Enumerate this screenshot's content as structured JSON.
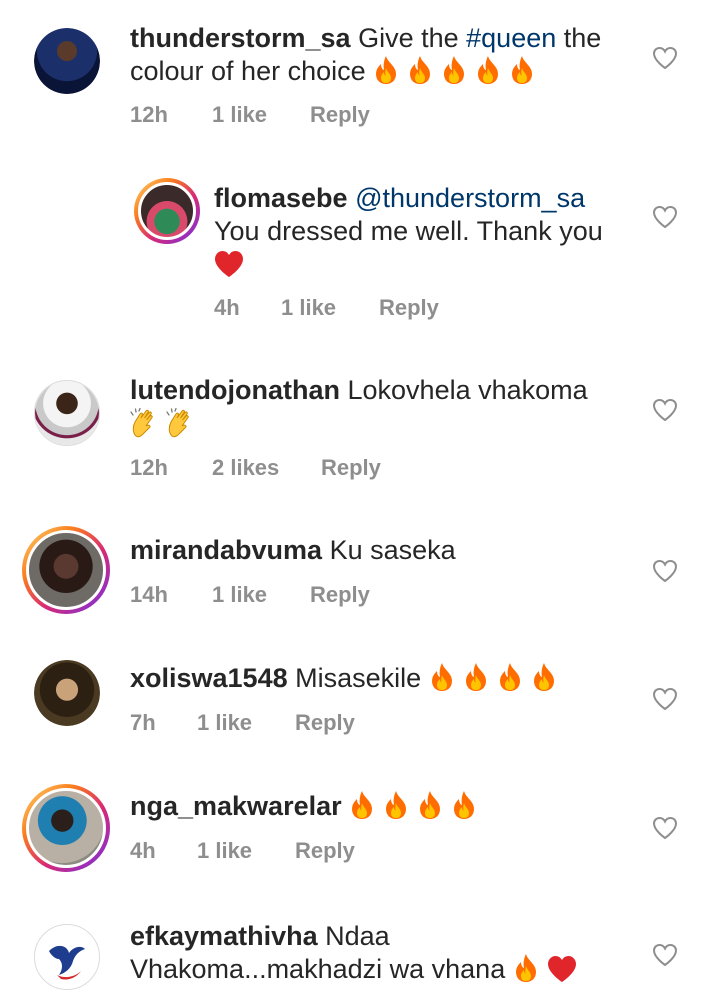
{
  "comments": [
    {
      "username": "thunderstorm_sa",
      "text_before": "Give the ",
      "hashtag": "#queen",
      "text_after": " the colour of her choice",
      "emoji": "fire ×5",
      "time": "12h",
      "likes": "1 like",
      "reply": "Reply"
    },
    {
      "username": "flomasebe",
      "mention": "@thunderstorm_sa",
      "text": "You dressed me well. Thank you",
      "emoji": "red heart",
      "time": "4h",
      "likes": "1 like",
      "reply": "Reply"
    },
    {
      "username": "lutendojonathan",
      "text": "Lokovhela vhakoma",
      "emoji": "clapping hands ×2",
      "time": "12h",
      "likes": "2 likes",
      "reply": "Reply"
    },
    {
      "username": "mirandabvuma",
      "text": "Ku saseka",
      "time": "14h",
      "likes": "1 like",
      "reply": "Reply"
    },
    {
      "username": "xoliswa1548",
      "text": "Misasekile",
      "emoji": "fire ×4",
      "time": "7h",
      "likes": "1 like",
      "reply": "Reply"
    },
    {
      "username": "nga_makwarelar",
      "text": "",
      "emoji": "fire ×4",
      "time": "4h",
      "likes": "1 like",
      "reply": "Reply"
    },
    {
      "username": "efkaymathivha",
      "text": "Ndaa",
      "text_line2": "Vhakoma...makhadzi wa vhana",
      "emoji": "fire, red heart"
    }
  ],
  "icons": {
    "like": "heart-outline-icon",
    "fire": "fire-emoji",
    "heart": "red-heart-emoji",
    "clap": "clap-emoji"
  },
  "colors": {
    "username": "#262626",
    "link": "#00376b",
    "meta": "#8e8e8e",
    "heart_outline": "#8e8e8e",
    "heart_red": "#e0262b"
  }
}
